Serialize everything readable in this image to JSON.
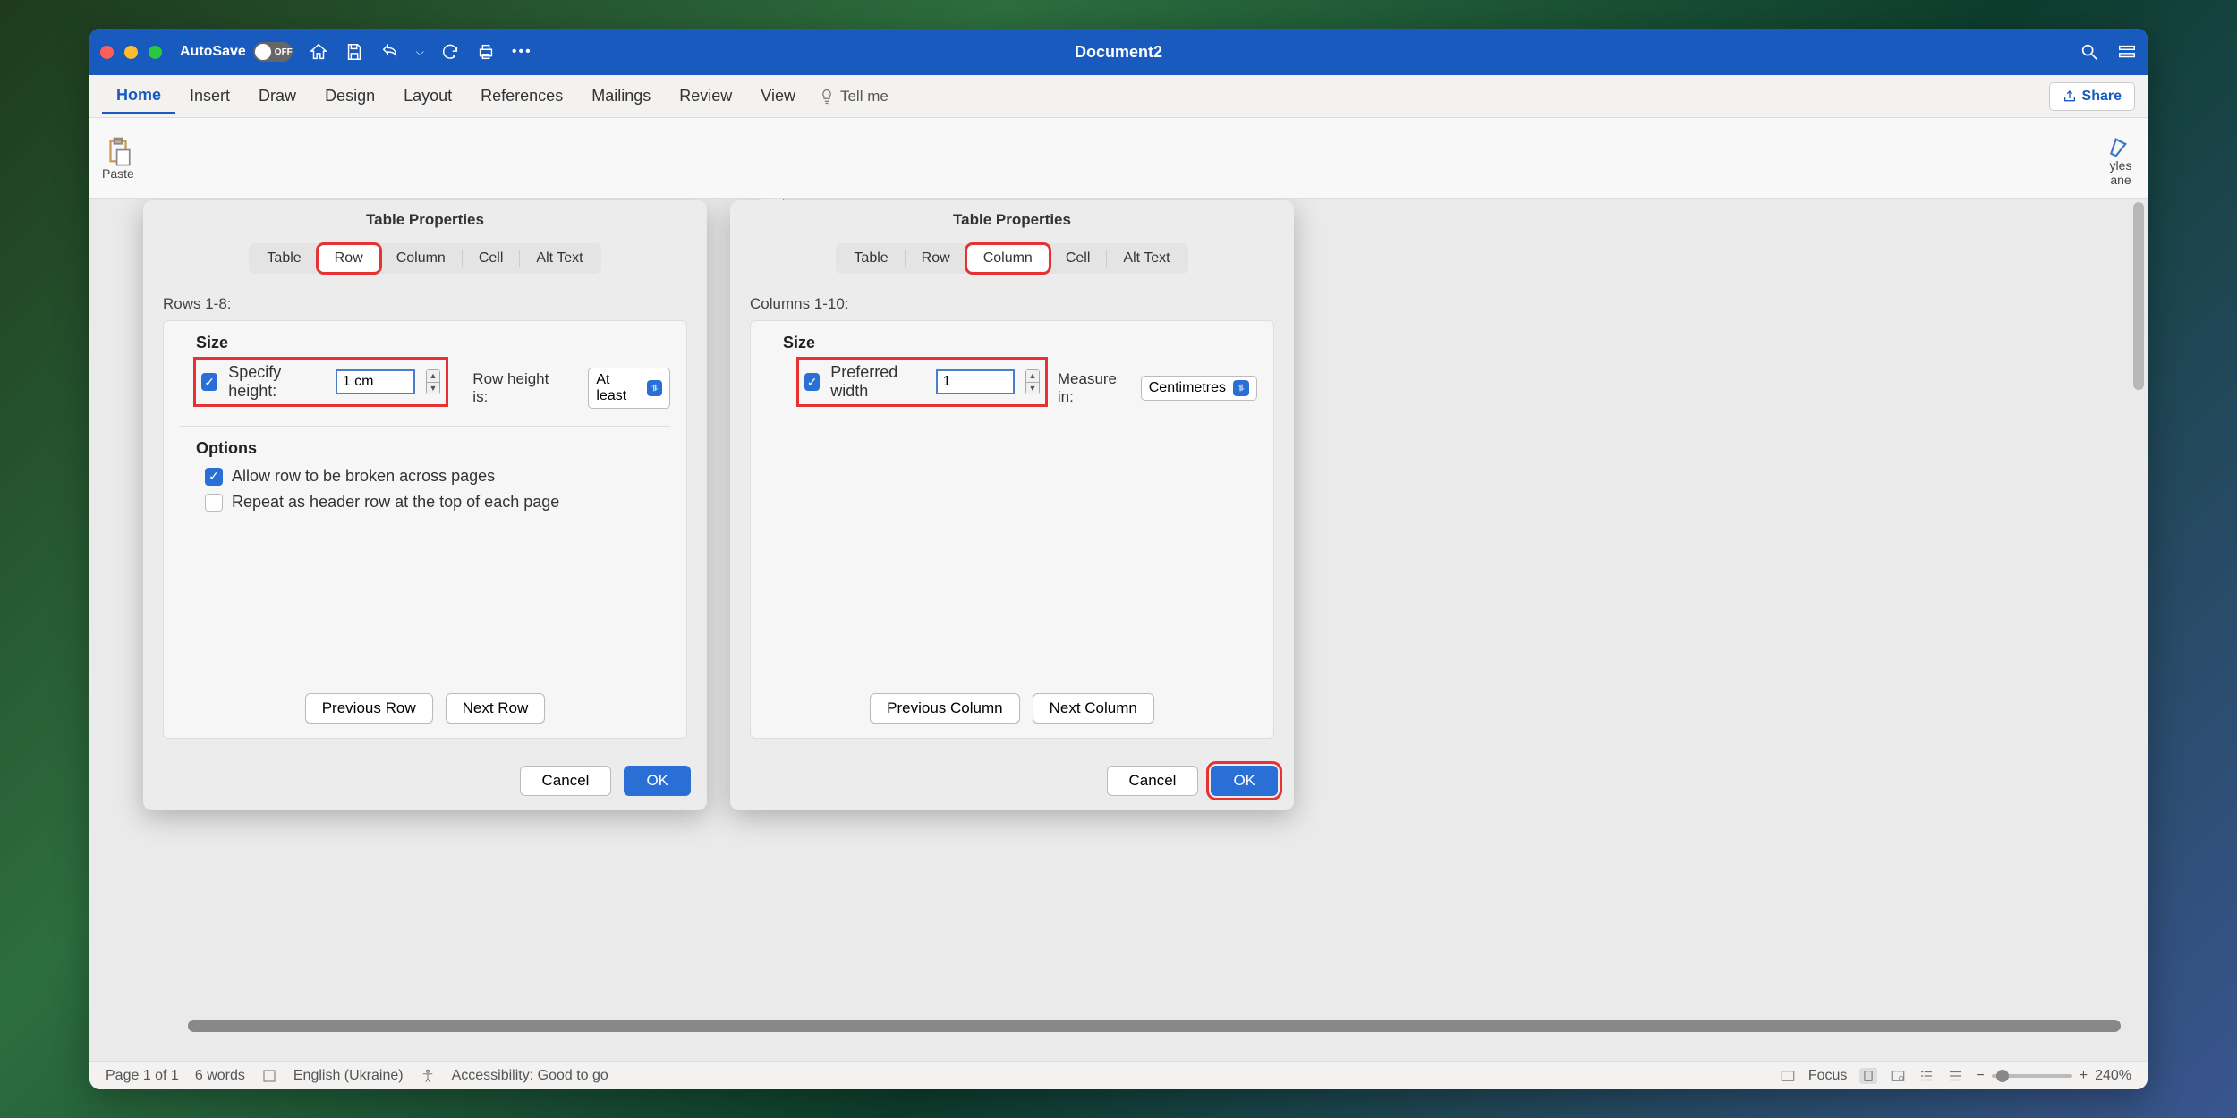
{
  "titlebar": {
    "autosave_label": "AutoSave",
    "autosave_state": "OFF",
    "doc_title": "Document2"
  },
  "ribbon_tabs": [
    "Home",
    "Insert",
    "Draw",
    "Design",
    "Layout",
    "References",
    "Mailings",
    "Review",
    "View"
  ],
  "tellme": "Tell me",
  "share": "Share",
  "paste": "Paste",
  "styles_pane": "yles\nane",
  "dialog": {
    "title": "Table Properties",
    "tabs": [
      "Table",
      "Row",
      "Column",
      "Cell",
      "Alt Text"
    ],
    "left": {
      "active_tab": "Row",
      "range_label": "Rows 1-8:",
      "size_heading": "Size",
      "specify_height_label": "Specify height:",
      "height_value": "1 cm",
      "row_height_is_label": "Row height is:",
      "row_height_mode": "At least",
      "options_heading": "Options",
      "allow_break": "Allow row to be broken across pages",
      "repeat_header": "Repeat as header row at the top of each page",
      "prev": "Previous Row",
      "next": "Next Row"
    },
    "right": {
      "active_tab": "Column",
      "range_label": "Columns 1-10:",
      "size_heading": "Size",
      "pref_width_label": "Preferred width",
      "width_value": "1",
      "measure_in_label": "Measure in:",
      "measure_unit": "Centimetres",
      "prev": "Previous Column",
      "next": "Next Column"
    },
    "cancel": "Cancel",
    "ok": "OK"
  },
  "statusbar": {
    "page": "Page 1 of 1",
    "words": "6 words",
    "lang": "English (Ukraine)",
    "a11y": "Accessibility: Good to go",
    "focus": "Focus",
    "zoom": "240%"
  }
}
